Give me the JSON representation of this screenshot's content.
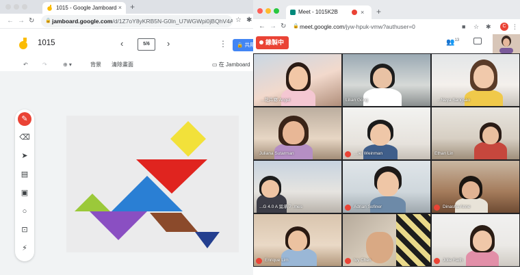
{
  "left_window": {
    "tab_title": "1015 - Google Jamboard",
    "tab_close": "×",
    "new_tab": "+",
    "url_host": "jamboard.google.com",
    "url_path": "/d/1Z7oY8yKRB5N-G0ln_U7WGWpi0jBQhV4A...",
    "board_title": "1015",
    "frame_counter": "5/6",
    "prev_glyph": "‹",
    "next_glyph": "›",
    "share_label": "共用",
    "tool_bg": "背景",
    "tool_clear": "清除畫面",
    "open_in_jamboard": "在 Jamboard"
  },
  "right_window": {
    "tab_title": "Meet - 1015K2B",
    "tab_close": "×",
    "new_tab": "+",
    "url_host": "meet.google.com",
    "url_path": "/jyw-hpuk-vmw?authuser=0",
    "recording_label": "錄製中",
    "participant_count": "13",
    "avatar_initial": "C"
  },
  "tiles": [
    {
      "label": "...花卉鄉 Angel",
      "muted": false,
      "dots": true
    },
    {
      "label": "Lilian Gong",
      "muted": false,
      "dots": false
    },
    {
      "label": "...Neya Sangsao",
      "muted": false,
      "dots": true
    },
    {
      "label": "Juliana Sutarman",
      "muted": false,
      "dots": true
    },
    {
      "label": "…iel Weinman",
      "muted": true,
      "dots": false
    },
    {
      "label": "Ethan Lin",
      "muted": false,
      "dots": false
    },
    {
      "label": "...G 4.0 A 吳承 7 .mes",
      "muted": false,
      "dots": true
    },
    {
      "label": "Adrian Sofiner",
      "muted": true,
      "dots": false
    },
    {
      "label": "Dinasha Anne",
      "muted": true,
      "dots": false
    },
    {
      "label": "Enrique Lim",
      "muted": true,
      "dots": false
    },
    {
      "label": "Ivy Chen",
      "muted": true,
      "dots": false
    },
    {
      "label": "Jolie Faith",
      "muted": true,
      "dots": false
    }
  ],
  "colors": {
    "record_red": "#ea4335",
    "share_blue": "#4285f4",
    "jam_yellow": "#fbbc04",
    "tangram_yellow": "#f2e13a",
    "tangram_red": "#e0241f",
    "tangram_blue": "#2a7fd4",
    "tangram_green": "#9bc93a",
    "tangram_purple": "#8a4fc2",
    "tangram_brown": "#8b4a2b",
    "tangram_navy": "#243f8f"
  },
  "icons": {
    "pen": "pen-icon",
    "eraser": "eraser-icon",
    "select": "pointer-icon",
    "sticky": "sticky-note-icon",
    "image": "image-icon",
    "shape": "circle-shape-icon",
    "textbox": "text-box-icon",
    "laser": "laser-icon"
  }
}
